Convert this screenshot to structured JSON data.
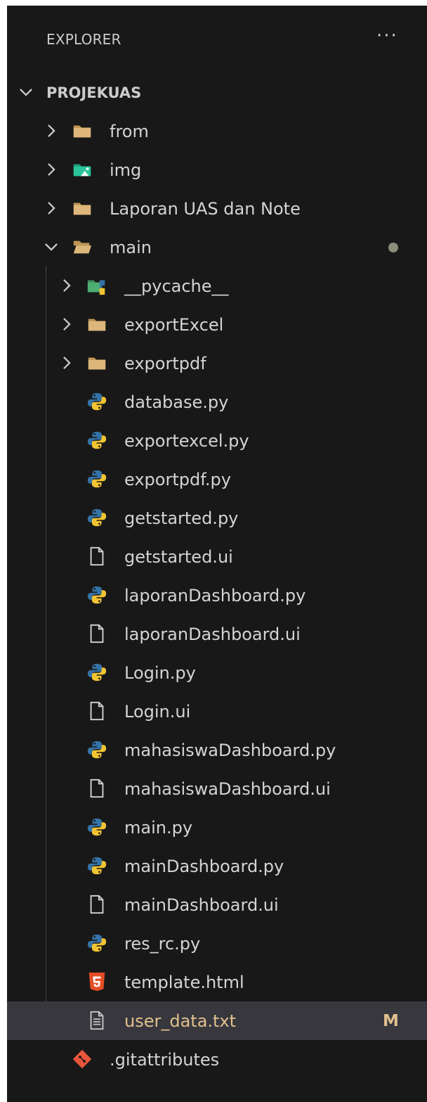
{
  "explorer": {
    "title": "EXPLORER",
    "more_actions": "···"
  },
  "tree": [
    {
      "label": "PROJEKUAS",
      "type": "root",
      "expanded": true
    },
    {
      "label": "from",
      "type": "folder",
      "icon": "folder-icon"
    },
    {
      "label": "img",
      "type": "folder",
      "icon": "image-folder-icon"
    },
    {
      "label": "Laporan UAS dan Note",
      "type": "folder",
      "icon": "folder-icon"
    },
    {
      "label": "main",
      "type": "folder",
      "expanded": true,
      "icon": "open-folder-icon",
      "status": "modified-dot"
    },
    {
      "label": "__pycache__",
      "type": "folder",
      "icon": "python-folder-icon"
    },
    {
      "label": "exportExcel",
      "type": "folder",
      "icon": "folder-icon"
    },
    {
      "label": "exportpdf",
      "type": "folder",
      "icon": "folder-icon"
    },
    {
      "label": "database.py",
      "type": "file",
      "icon": "python-icon"
    },
    {
      "label": "exportexcel.py",
      "type": "file",
      "icon": "python-icon"
    },
    {
      "label": "exportpdf.py",
      "type": "file",
      "icon": "python-icon"
    },
    {
      "label": "getstarted.py",
      "type": "file",
      "icon": "python-icon"
    },
    {
      "label": "getstarted.ui",
      "type": "file",
      "icon": "file-icon"
    },
    {
      "label": "laporanDashboard.py",
      "type": "file",
      "icon": "python-icon"
    },
    {
      "label": "laporanDashboard.ui",
      "type": "file",
      "icon": "file-icon"
    },
    {
      "label": "Login.py",
      "type": "file",
      "icon": "python-icon"
    },
    {
      "label": "Login.ui",
      "type": "file",
      "icon": "file-icon"
    },
    {
      "label": "mahasiswaDashboard.py",
      "type": "file",
      "icon": "python-icon"
    },
    {
      "label": "mahasiswaDashboard.ui",
      "type": "file",
      "icon": "file-icon"
    },
    {
      "label": "main.py",
      "type": "file",
      "icon": "python-icon"
    },
    {
      "label": "mainDashboard.py",
      "type": "file",
      "icon": "python-icon"
    },
    {
      "label": "mainDashboard.ui",
      "type": "file",
      "icon": "file-icon"
    },
    {
      "label": "res_rc.py",
      "type": "file",
      "icon": "python-icon"
    },
    {
      "label": "template.html",
      "type": "file",
      "icon": "html5-icon"
    },
    {
      "label": "user_data.txt",
      "type": "file",
      "icon": "text-file-icon",
      "selected": true,
      "badge": "M"
    },
    {
      "label": ".gitattributes",
      "type": "file",
      "icon": "git-icon"
    }
  ],
  "colors": {
    "panel_bg": "#181818",
    "selected_bg": "#37373d",
    "modified": "#e2c08d",
    "folder": "#c09553",
    "python_blue": "#3572a5",
    "python_yellow": "#f3c432",
    "html_orange": "#e44d26",
    "git_orange": "#e8553b"
  }
}
